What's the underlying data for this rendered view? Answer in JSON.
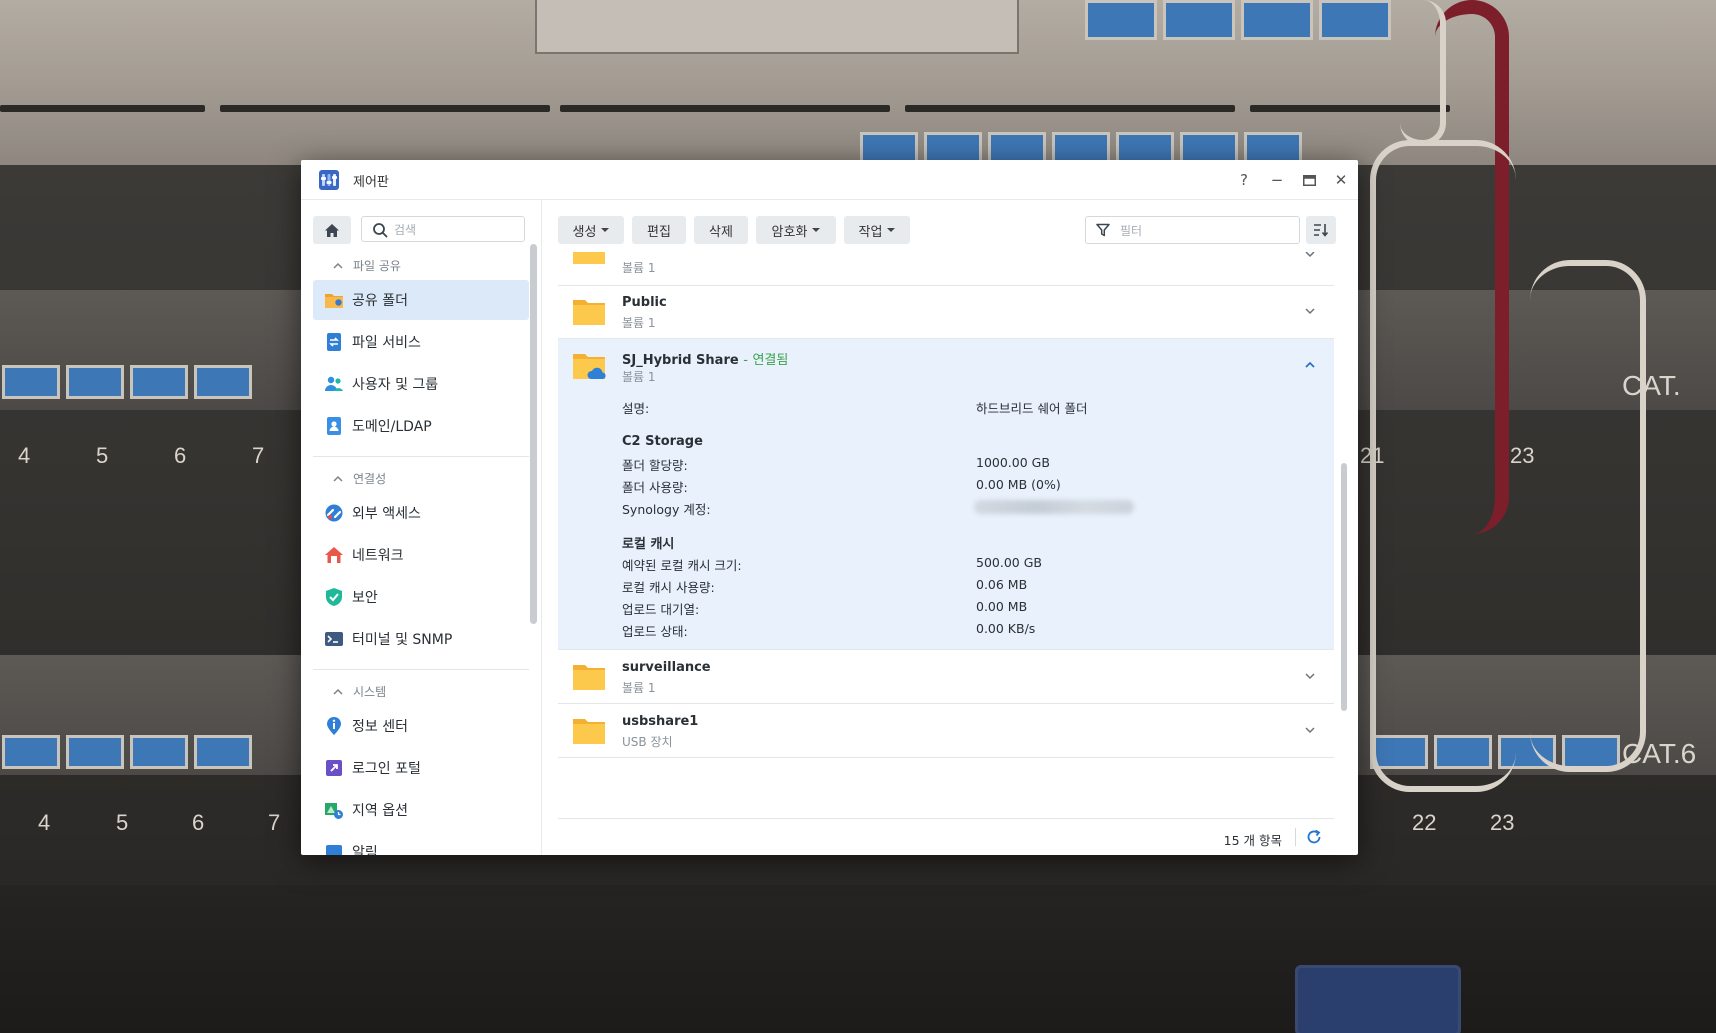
{
  "window": {
    "title": "제어판"
  },
  "controls": {
    "help": "?",
    "minimize": "−",
    "maximize": "▭",
    "close": "✕"
  },
  "sidebar": {
    "search_placeholder": "검색",
    "sections": [
      {
        "title": "파일 공유",
        "items": [
          {
            "label": "공유 폴더",
            "icon": "shared-folder-icon",
            "active": true
          },
          {
            "label": "파일 서비스",
            "icon": "file-services-icon"
          },
          {
            "label": "사용자 및 그룹",
            "icon": "users-groups-icon"
          },
          {
            "label": "도메인/LDAP",
            "icon": "domain-ldap-icon"
          }
        ]
      },
      {
        "title": "연결성",
        "items": [
          {
            "label": "외부 액세스",
            "icon": "external-access-icon"
          },
          {
            "label": "네트워크",
            "icon": "network-icon"
          },
          {
            "label": "보안",
            "icon": "security-shield-icon"
          },
          {
            "label": "터미널 및 SNMP",
            "icon": "terminal-icon"
          }
        ]
      },
      {
        "title": "시스템",
        "items": [
          {
            "label": "정보 센터",
            "icon": "info-center-icon"
          },
          {
            "label": "로그인 포털",
            "icon": "login-portal-icon"
          },
          {
            "label": "지역 옵션",
            "icon": "regional-options-icon"
          },
          {
            "label": "알림",
            "icon": "notification-icon"
          }
        ]
      }
    ]
  },
  "toolbar": {
    "create": "생성",
    "edit": "편집",
    "delete": "삭제",
    "encryption": "암호화",
    "action": "작업",
    "filter_placeholder": "필터"
  },
  "folders": [
    {
      "name": "",
      "sub": "볼륨 1"
    },
    {
      "name": "Public",
      "sub": "볼륨 1"
    },
    {
      "name": "SJ_Hybrid Share",
      "status": "연결됨",
      "sub": "볼륨 1",
      "expanded": true,
      "details": {
        "description_label": "설명:",
        "description_value": "하드브리드 쉐어 폴더",
        "c2_heading": "C2 Storage",
        "quota_label": "폴더 할당량:",
        "quota_value": "1000.00 GB",
        "usage_label": "폴더 사용량:",
        "usage_value": "0.00 MB (0%)",
        "account_label": "Synology 계정:",
        "cache_heading": "로컬 캐시",
        "reserved_label": "예약된 로컬 캐시 크기:",
        "reserved_value": "500.00 GB",
        "cache_usage_label": "로컬 캐시 사용량:",
        "cache_usage_value": "0.06 MB",
        "queue_label": "업로드 대기열:",
        "queue_value": "0.00 MB",
        "upload_label": "업로드 상태:",
        "upload_value": "0.00 KB/s"
      }
    },
    {
      "name": "surveillance",
      "sub": "볼륨 1"
    },
    {
      "name": "usbshare1",
      "sub": "USB 장치"
    }
  ],
  "footer": {
    "count": "15 개 항목"
  },
  "colors": {
    "accent": "#1f77d0",
    "connected": "#3aa24b",
    "selected": "#dce9f8",
    "expanded": "#e8f1fc"
  }
}
